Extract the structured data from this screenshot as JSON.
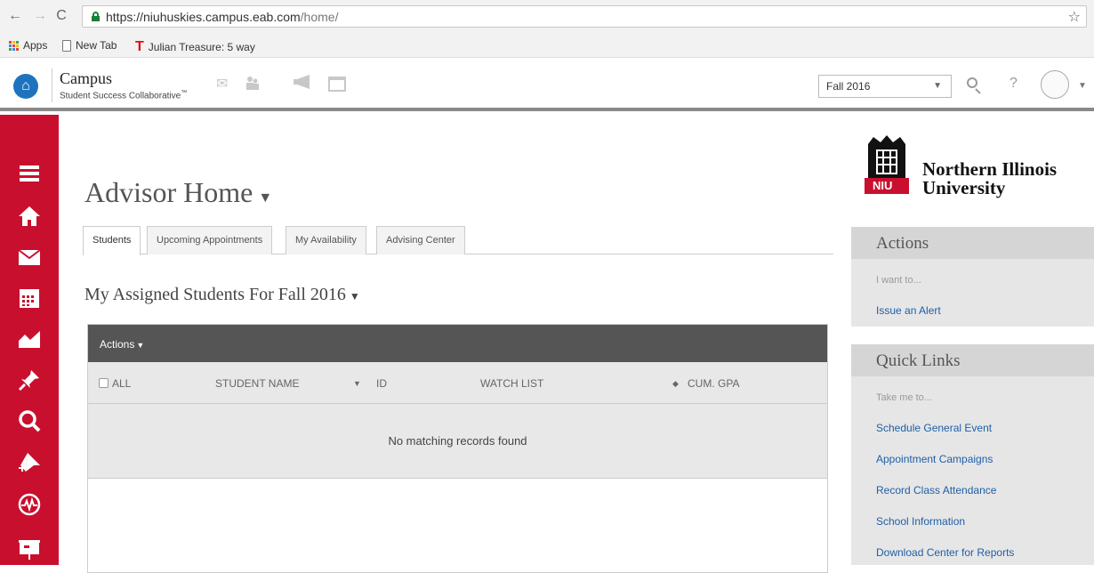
{
  "browser": {
    "url_host": "https://niuhuskies.campus.eab.com",
    "url_path": "/home/",
    "bookmarks": [
      "Apps",
      "New Tab",
      "Julian Treasure: 5 way"
    ]
  },
  "header": {
    "brand_title": "Campus",
    "brand_subtitle": "Student Success Collaborative",
    "trademark": "™",
    "term_value": "Fall 2016",
    "help_glyph": "?"
  },
  "sidebar": {
    "color": "#c8102e",
    "items": [
      "menu-icon",
      "home-icon",
      "mail-icon",
      "calendar-icon",
      "chart-icon",
      "pin-icon",
      "search-icon",
      "add-pin-icon",
      "pulse-icon",
      "presentation-icon"
    ]
  },
  "main": {
    "page_title": "Advisor Home",
    "tabs": [
      "Students",
      "Upcoming Appointments",
      "My Availability",
      "Advising Center"
    ],
    "section_title": "My Assigned Students For Fall 2016",
    "table": {
      "actions_label": "Actions",
      "columns": [
        "ALL",
        "STUDENT NAME",
        "ID",
        "WATCH LIST",
        "CUM. GPA"
      ],
      "empty_message": "No matching records found"
    }
  },
  "right": {
    "university_line1": "Northern Illinois",
    "university_line2": "University",
    "logo_text": "NIU",
    "actions_panel": {
      "title": "Actions",
      "subtitle": "I want to...",
      "links": [
        "Issue an Alert"
      ]
    },
    "quick_links_panel": {
      "title": "Quick Links",
      "subtitle": "Take me to...",
      "links": [
        "Schedule General Event",
        "Appointment Campaigns",
        "Record Class Attendance",
        "School Information",
        "Download Center for Reports"
      ]
    }
  }
}
